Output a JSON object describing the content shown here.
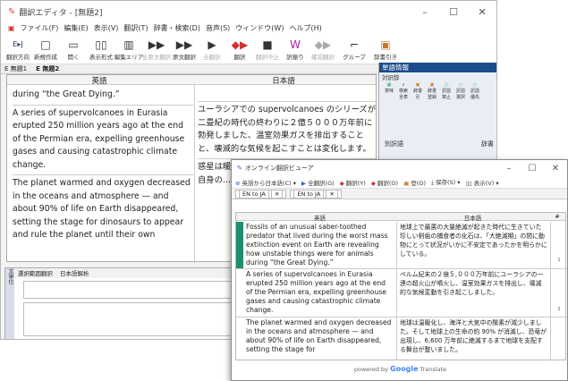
{
  "main": {
    "title": "翻訳エディタ - [無題2]",
    "menu": [
      "ファイル(F)",
      "編集(E)",
      "表示(V)",
      "翻訳(T)",
      "辞書・検索(D)",
      "音声(S)",
      "ウィンドウ(W)",
      "ヘルプ(H)"
    ],
    "toolbar": [
      {
        "label": "翻訳方向",
        "icon": "E▸J"
      },
      {
        "label": "新規作成",
        "icon": "□"
      },
      {
        "label": "開く",
        "icon": "▭"
      },
      {
        "label": "表示形式",
        "icon": "▯▯"
      },
      {
        "label": "編集エリア",
        "icon": "▥"
      },
      {
        "label": "全原文翻訳",
        "icon": "▶▶"
      },
      {
        "label": "原文翻訳",
        "icon": "▶▶"
      },
      {
        "label": "全翻訳",
        "icon": "▶"
      },
      {
        "label": "翻訳",
        "icon": "◆▶"
      },
      {
        "label": "翻訳中止",
        "icon": "■"
      },
      {
        "label": "訳振り",
        "icon": "W"
      },
      {
        "label": "確認翻訳",
        "icon": "◆▶"
      },
      {
        "label": "グループ",
        "icon": "⌐"
      },
      {
        "label": "辞書引き",
        "icon": "▣"
      }
    ],
    "tabs": [
      "E 無題1",
      "E 無題2"
    ],
    "pane_headers": {
      "src": "英語",
      "tgt": "日本語"
    },
    "source_paragraphs": [
      "during “the Great Dying.”",
      "A series of supervolcanoes in Eurasia erupted 250 million years ago at the end of the Permian era, expelling greenhouse gases and causing catastrophic climate change.",
      "The planet warmed and oxygen decreased in the oceans and atmosphere — and about 90% of life on Earth disappeared, setting the stage for dinosaurs to appear and rule the planet until their own"
    ],
    "target_paragraphs": [
      "ユーラシアでの supervolcanoes のシリーズが二畳紀の時代の終わりに２億５０００万年前に勃発しました、温室効果ガスを排出することと、壊滅的な気候を起こすことは変化します。",
      "惑星は暖かく…大気で減少し…に地球上の…ら）自身の…て恐竜を支配…"
    ],
    "side_panel": {
      "header": "単語情報",
      "sub": "対訳辞",
      "icon_labels": [
        "意味",
        "検索全表",
        "辞書引",
        "辞書登録",
        "訳語禁止",
        "訳語選択",
        "訳語優先"
      ],
      "columns": [
        "別訳語",
        "辞書"
      ]
    },
    "bottom": {
      "side_label": "文単位",
      "tabs": [
        "選択範囲翻訳",
        "日本語解析"
      ]
    }
  },
  "viewer": {
    "title": "オンライン翻訳ビューア",
    "toolbar": [
      "英語から日本語(C)",
      "全翻訳(G)",
      "翻訳(Y)",
      "翻訳(O)",
      "登(O)",
      "保存(S)",
      "表示(V)"
    ],
    "tabs": [
      "EN to JA",
      "EN to JA"
    ],
    "headers": {
      "en": "英語",
      "ja": "日本語",
      "num": "#"
    },
    "rows": [
      {
        "en": "Fossils of an unusual saber-toothed predator that lived during the worst mass extinction event on Earth are revealing how unstable things were for animals during “the Great Dying.”",
        "ja": "地球上で最悪の大量絶滅が起きた時代に生きていた珍しい剣歯の捕食者の化石は、「大絶滅期」の間に動物にとって状況がいかに不安定であったかを明らかにしている。",
        "num": "1",
        "mark": "#1e8c6f"
      },
      {
        "en": "A series of supervolcanoes in Eurasia erupted 250 million years ago at the end of the Permian era, expelling greenhouse gases and causing catastrophic climate change.",
        "ja": "ペルム紀末の２億５,０００万年前にユーラシアの一連の超火山が噴火し、温室効果ガスを排出し、壊滅的な気候変動を引き起こしました。",
        "num": "2",
        "mark": ""
      },
      {
        "en": "The planet warmed and oxygen decreased in the oceans and atmosphere — and about 90% of life on Earth disappeared, setting the stage for",
        "ja": "地球は温暖化し、海洋と大気中の酸素が減少しました。そして地球上の生命の約 90% が消滅し、恐竜が出現し、6,600 万年前に絶滅するまで地球を支配する舞台が整いました。",
        "num": "",
        "mark": ""
      }
    ],
    "footer_prefix": "powered by",
    "footer_brand": "Google",
    "footer_suffix": "Translate"
  }
}
